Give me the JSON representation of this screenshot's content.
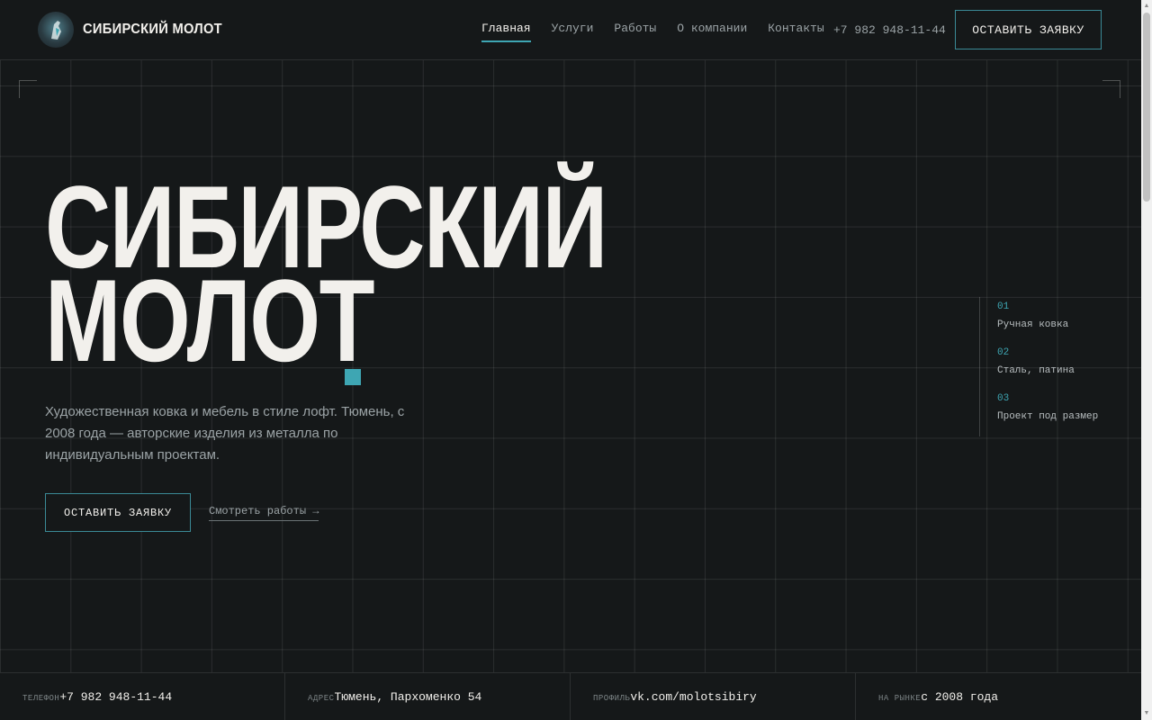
{
  "brand": {
    "name": "СИБИРСКИЙ МОЛОТ",
    "logo_icon": "hammer-bird-logo-icon"
  },
  "nav": {
    "items": [
      {
        "label": "Главная",
        "active": true
      },
      {
        "label": "Услуги",
        "active": false
      },
      {
        "label": "Работы",
        "active": false
      },
      {
        "label": "О компании",
        "active": false
      },
      {
        "label": "Контакты",
        "active": false
      }
    ],
    "phone": "+7 982 948-11-44",
    "cta_label": "ОСТАВИТЬ ЗАЯВКУ"
  },
  "hero": {
    "title_line1": "СИБИРСКИЙ",
    "title_line2": "МОЛОТ",
    "subtitle": "Художественная ковка и мебель в стиле лофт. Тюмень, с 2008 года — авторские изделия из металла по индивидуальным проектам.",
    "cta_label": "ОСТАВИТЬ ЗАЯВКУ",
    "link_label": "Смотреть работы →"
  },
  "features": [
    {
      "num": "01",
      "label": "Ручная ковка"
    },
    {
      "num": "02",
      "label": "Сталь, патина"
    },
    {
      "num": "03",
      "label": "Проект под размер"
    }
  ],
  "footer": [
    {
      "key": "ТЕЛЕФОН",
      "value": "+7 982 948-11-44"
    },
    {
      "key": "АДРЕС",
      "value": "Тюмень, Пархоменко 54"
    },
    {
      "key": "ПРОФИЛЬ",
      "value": "vk.com/molotsibiry"
    },
    {
      "key": "НА РЫНКЕ",
      "value": "с 2008 года"
    }
  ],
  "colors": {
    "background": "#151819",
    "accent": "#3ea6b3",
    "text": "#f2f0ec",
    "muted": "#9ba3a6"
  }
}
